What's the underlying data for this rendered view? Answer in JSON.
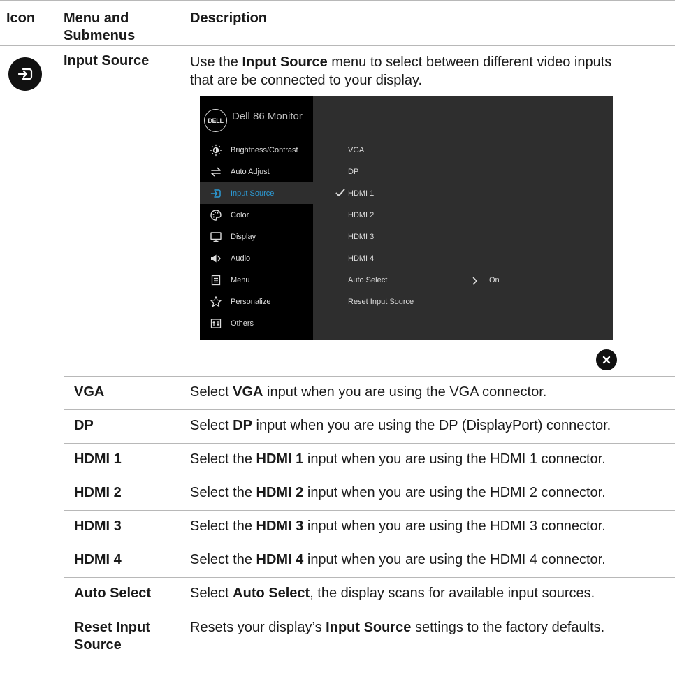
{
  "header": {
    "col_icon": "Icon",
    "col_menu_line1": "Menu and",
    "col_menu_line2": "Submenus",
    "col_desc": "Description"
  },
  "section": {
    "icon": "input-source-icon",
    "name": "Input Source",
    "intro_before": "Use the ",
    "intro_bold": "Input Source",
    "intro_after": " menu to select between different video inputs that are be connected to your display."
  },
  "osd": {
    "logo": "DELL",
    "title": "Dell 86 Monitor",
    "accent_color": "#2c9bd6",
    "menu_items": [
      {
        "label": "Brightness/Contrast",
        "icon": "brightness-icon",
        "active": false
      },
      {
        "label": "Auto Adjust",
        "icon": "auto-adjust-icon",
        "active": false
      },
      {
        "label": "Input Source",
        "icon": "input-source-icon",
        "active": true
      },
      {
        "label": "Color",
        "icon": "color-palette-icon",
        "active": false
      },
      {
        "label": "Display",
        "icon": "monitor-icon",
        "active": false
      },
      {
        "label": "Audio",
        "icon": "speaker-icon",
        "active": false
      },
      {
        "label": "Menu",
        "icon": "menu-list-icon",
        "active": false
      },
      {
        "label": "Personalize",
        "icon": "star-icon",
        "active": false
      },
      {
        "label": "Others",
        "icon": "others-icon",
        "active": false
      }
    ],
    "sub_items": [
      "VGA",
      "DP",
      "HDMI 1",
      "HDMI 2",
      "HDMI 3",
      "HDMI 4",
      "Auto Select",
      "Reset Input Source"
    ],
    "selected_sub": "HDMI 1",
    "auto_select_value": "On"
  },
  "rows": [
    {
      "label": "VGA",
      "pre": "Select ",
      "bold": "VGA",
      "post": " input when you are using the VGA connector."
    },
    {
      "label": "DP",
      "pre": "Select ",
      "bold": "DP",
      "post": " input when you are using the DP (DisplayPort) connector."
    },
    {
      "label": "HDMI 1",
      "pre": "Select the ",
      "bold": "HDMI 1",
      "post": " input when you are using the HDMI 1 connector."
    },
    {
      "label": "HDMI 2",
      "pre": "Select the ",
      "bold": "HDMI 2",
      "post": " input when you are using the HDMI 2 connector."
    },
    {
      "label": "HDMI 3",
      "pre": "Select the ",
      "bold": "HDMI 3",
      "post": " input when you are using the HDMI 3 connector."
    },
    {
      "label": "HDMI 4",
      "pre": "Select the ",
      "bold": "HDMI 4",
      "post": " input when you are using the HDMI 4 connector."
    },
    {
      "label": "Auto Select",
      "pre": "Select ",
      "bold": "Auto Select",
      "post": ", the display scans for available input sources."
    },
    {
      "label_line1": "Reset Input",
      "label_line2": "Source",
      "pre": "Resets your display’s ",
      "bold": "Input Source",
      "post": " settings to the factory defaults."
    }
  ]
}
